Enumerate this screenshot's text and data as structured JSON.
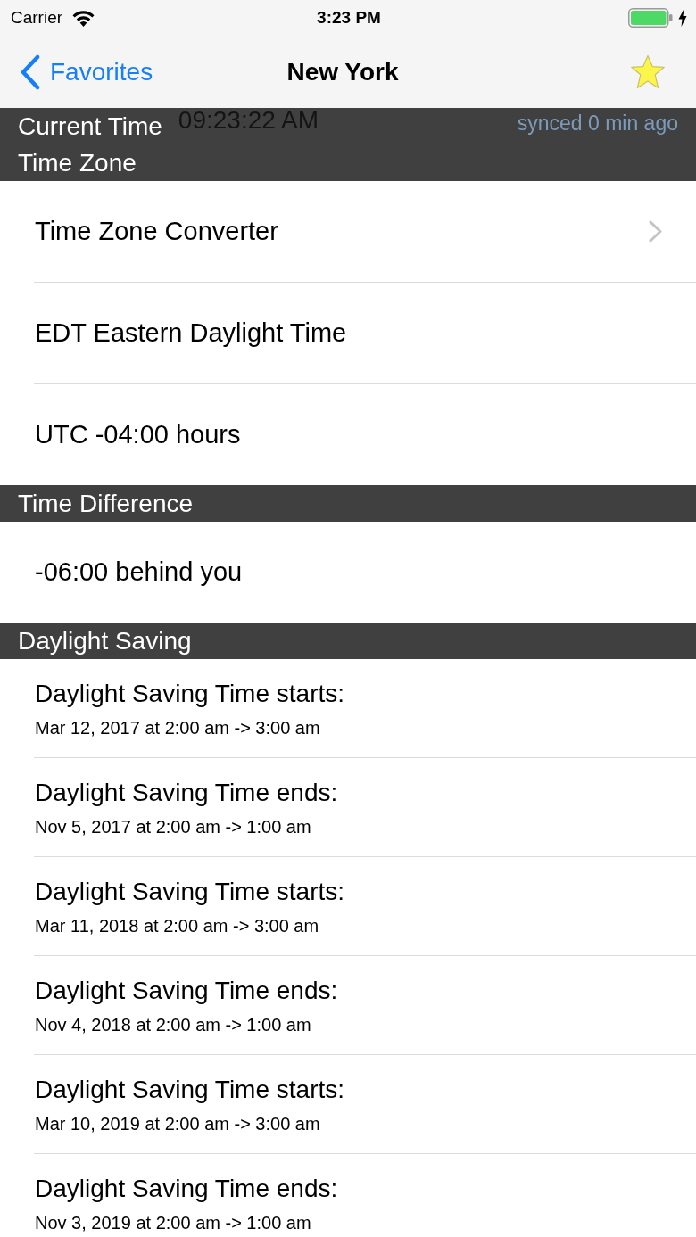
{
  "status_bar": {
    "carrier": "Carrier",
    "time": "3:23 PM"
  },
  "nav_bar": {
    "back_label": "Favorites",
    "title": "New York",
    "favorite": true
  },
  "current_time": {
    "header": "Current Time",
    "time": "09:23:22 AM",
    "sync_status": "synced 0 min ago"
  },
  "sections": [
    {
      "header": "Time Zone",
      "rows": [
        {
          "kind": "link",
          "label": "Time Zone Converter"
        },
        {
          "kind": "plain",
          "label": "EDT Eastern Daylight Time"
        },
        {
          "kind": "plain",
          "label": "UTC -04:00 hours"
        }
      ]
    },
    {
      "header": "Time Difference",
      "rows": [
        {
          "kind": "plain",
          "label": "-06:00 behind you"
        }
      ]
    },
    {
      "header": "Daylight Saving",
      "rows": [
        {
          "kind": "event",
          "label": "Daylight Saving Time starts:",
          "detail": "Mar 12, 2017 at 2:00 am -> 3:00 am"
        },
        {
          "kind": "event",
          "label": "Daylight Saving Time ends:",
          "detail": "Nov 5, 2017 at 2:00 am -> 1:00 am"
        },
        {
          "kind": "event",
          "label": "Daylight Saving Time starts:",
          "detail": "Mar 11, 2018 at 2:00 am -> 3:00 am"
        },
        {
          "kind": "event",
          "label": "Daylight Saving Time ends:",
          "detail": "Nov 4, 2018 at 2:00 am -> 1:00 am"
        },
        {
          "kind": "event",
          "label": "Daylight Saving Time starts:",
          "detail": "Mar 10, 2019 at 2:00 am -> 3:00 am"
        },
        {
          "kind": "event",
          "label": "Daylight Saving Time ends:",
          "detail": "Nov 3, 2019 at 2:00 am -> 1:00 am"
        }
      ]
    }
  ]
}
